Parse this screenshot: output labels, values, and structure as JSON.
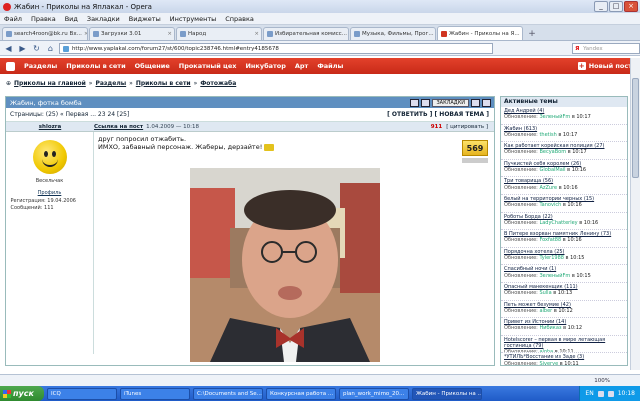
{
  "window": {
    "title": "Жабин - Приколы на Яплакал - Opera"
  },
  "menu": [
    "Файл",
    "Правка",
    "Вид",
    "Закладки",
    "Виджеты",
    "Инструменты",
    "Справка"
  ],
  "tabs": [
    {
      "label": "search4roon@bk.ru Вх..."
    },
    {
      "label": "Загрузки 3.01"
    },
    {
      "label": "Народ"
    },
    {
      "label": "Избирательная комисс..."
    },
    {
      "label": "Музыка, Фильмы, Прог..."
    },
    {
      "label": "Жабин - Приколы на Я..."
    }
  ],
  "address": {
    "url": "http://www.yaplakal.com/forum27/st/600/topic238746.html#entry4185678",
    "search_placeholder": "Yandex"
  },
  "sitenav": {
    "items": [
      "Разделы",
      "Приколы в сети",
      "Общение",
      "Прокатный цех",
      "Инкубатор",
      "Арт",
      "Файлы"
    ],
    "new_post": "Новый пост"
  },
  "breadcrumbs": [
    "Приколы на главной",
    "Разделы",
    "Приколы в сети",
    "Фотожаба"
  ],
  "thread": {
    "title": "Жабин, фотка бомба",
    "bookmark": "ЗАКЛАДКИ",
    "pages_text": "Страницы: (25) « Первая ... 23 24 [25]",
    "actions": "[ ОТВЕТИТЬ ] [ НОВАЯ ТЕМА ]"
  },
  "post": {
    "author": "shlozra",
    "link_label": "Ссылка на пост",
    "date": "1.04.2009 — 10:18",
    "number": "911",
    "quote_label": "[ цитировать ]",
    "line1": "друг попросил отжабить.",
    "line2": "ИМХО, забавный персонаж. Жаберы, дерзайте!",
    "rating": "569",
    "author_status": "Весельчак",
    "profile_label": "Профиль",
    "registered": "Регистрация: 19.04.2006",
    "messages": "Сообщений: 111"
  },
  "sidebar": {
    "title": "Активные темы",
    "update_label": "Обновление:",
    "topics": [
      {
        "title": "Дед Андрей (4)",
        "user": "ЗеленыйFm",
        "time": "в 10:17"
      },
      {
        "title": "Жабин (613)",
        "user": "thetish",
        "time": "в 10:17"
      },
      {
        "title": "Как работает корейская полиция (27)",
        "user": "BecyaBom",
        "time": "в 10:17"
      },
      {
        "title": "Пучкистей себя королем (26)",
        "user": "GlobalMail",
        "time": "в 10:16"
      },
      {
        "title": "Три товарища (56)",
        "user": "AzZure",
        "time": "в 10:16"
      },
      {
        "title": "белый на территории черных (15)",
        "user": "Tanovich",
        "time": "в 10:16"
      },
      {
        "title": "Роботы Борда (22)",
        "user": "LadyChatterley",
        "time": "в 10:16"
      },
      {
        "title": "В Питере взорван памятник Ленину (73)",
        "user": "Foxfat88",
        "time": "в 10:16"
      },
      {
        "title": "Порядочна хотела (25)",
        "user": "Tyler1988",
        "time": "в 10:15"
      },
      {
        "title": "Спасибный ночи (1)",
        "user": "ЗеленыйFm",
        "time": "в 10:15"
      },
      {
        "title": "Опасный манекенщик (111)",
        "user": "Sulla",
        "time": "в 10:13"
      },
      {
        "title": "Петь может безумие (42)",
        "user": "alber",
        "time": "в 10:12"
      },
      {
        "title": "Привет из Истонии (14)",
        "user": "Нибиказ",
        "time": "в 10:12"
      },
      {
        "title": "Hotelscorer – первая в мире летающая гостиница (79)",
        "user": "aloha",
        "time": "в 10:11"
      },
      {
        "title": "*УТИЛЬ*Восстание из Заде (3)",
        "user": "Siverye",
        "time": "в 10:11"
      }
    ]
  },
  "status": {
    "zoom": "100%"
  },
  "taskbar": {
    "start": "пуск",
    "tasks": [
      "ICQ",
      "iTunes",
      "C:\\Documents and Se...",
      "Конкурсная работа ...",
      "plan_work_mimo_20...",
      "Жабин - Приколы на ..."
    ],
    "lang": "EN",
    "clock": "10:18"
  },
  "colors": {
    "site_red": "#d03520",
    "header_blue": "#5f8fc0",
    "taskbar": "#2566d8"
  }
}
